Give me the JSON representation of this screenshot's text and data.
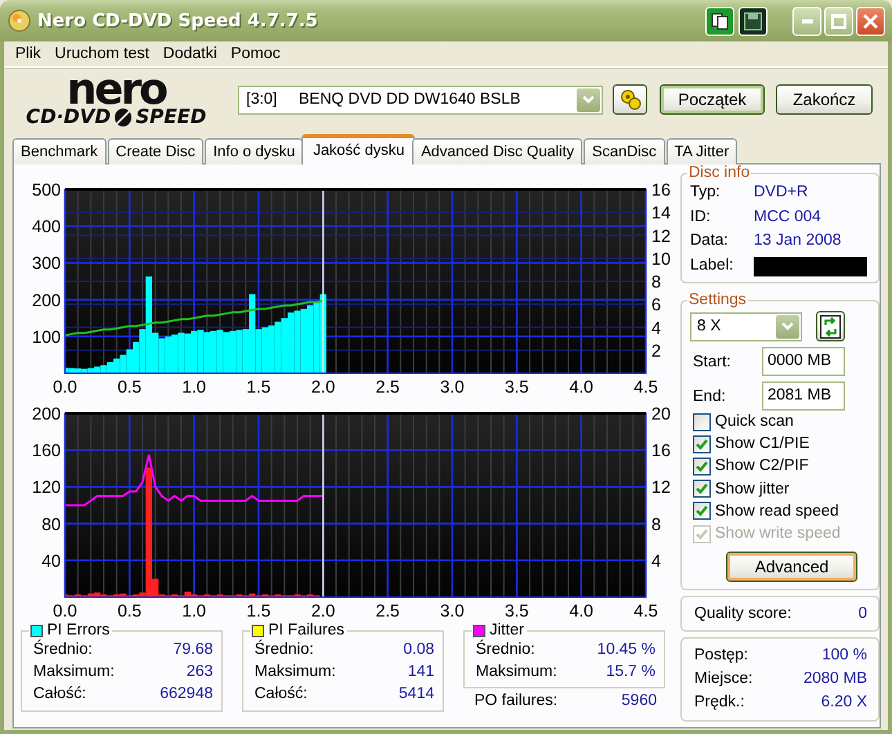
{
  "window": {
    "title": "Nero CD-DVD Speed 4.7.7.5"
  },
  "menu": [
    "Plik",
    "Uruchom test",
    "Dodatki",
    "Pomoc"
  ],
  "logo": {
    "top": "nero",
    "left": "CD·DVD",
    "right": "SPEED"
  },
  "drive": {
    "address": "[3:0]",
    "name": "BENQ DVD DD DW1640 BSLB"
  },
  "buttons": [
    {
      "label": "Początek",
      "focused": true
    },
    {
      "label": "Zakończ",
      "focused": false
    }
  ],
  "tabs": [
    {
      "label": "Benchmark",
      "selected": false
    },
    {
      "label": "Create Disc",
      "selected": false
    },
    {
      "label": "Info o dysku",
      "selected": false
    },
    {
      "label": "Jakość dysku",
      "selected": true
    },
    {
      "label": "Advanced Disc Quality",
      "selected": false
    },
    {
      "label": "ScanDisc",
      "selected": false
    },
    {
      "label": "TA Jitter",
      "selected": false
    }
  ],
  "charts": [
    {
      "chart_data": {
        "type": "bar",
        "x": [
          0,
          0.05,
          0.1,
          0.15,
          0.2,
          0.25,
          0.3,
          0.35,
          0.4,
          0.45,
          0.5,
          0.55,
          0.6,
          0.65,
          0.7,
          0.75,
          0.8,
          0.85,
          0.9,
          0.95,
          1.0,
          1.05,
          1.1,
          1.15,
          1.2,
          1.25,
          1.3,
          1.35,
          1.4,
          1.45,
          1.5,
          1.55,
          1.6,
          1.65,
          1.7,
          1.75,
          1.8,
          1.85,
          1.9,
          1.95,
          2.0
        ],
        "xlim": [
          0,
          4.5
        ],
        "ylim": [
          0,
          500
        ],
        "y2lim": [
          0,
          16
        ],
        "xticks": [
          {
            "value": 0,
            "label": "0.0"
          },
          {
            "value": 0.5,
            "label": "0.5"
          },
          {
            "value": 1,
            "label": "1.0"
          },
          {
            "value": 1.5,
            "label": "1.5"
          },
          {
            "value": 2,
            "label": "2.0"
          },
          {
            "value": 2.5,
            "label": "2.5"
          },
          {
            "value": 3,
            "label": "3.0"
          },
          {
            "value": 3.5,
            "label": "3.5"
          },
          {
            "value": 4,
            "label": "4.0"
          },
          {
            "value": 4.5,
            "label": "4.5"
          }
        ],
        "yticks": [
          100,
          200,
          300,
          400,
          500
        ],
        "y2ticks": [
          2,
          4,
          6,
          8,
          10,
          12,
          14,
          16
        ],
        "series": [
          {
            "color": "#00ffff",
            "values": [
              15,
              14,
              13,
              12,
              14,
              18,
              22,
              30,
              40,
              50,
              65,
              85,
              120,
              263,
              110,
              95,
              100,
              105,
              110,
              108,
              115,
              118,
              112,
              115,
              118,
              112,
              115,
              118,
              120,
              215,
              120,
              125,
              130,
              140,
              150,
              165,
              170,
              175,
              185,
              195,
              215
            ]
          },
          {
            "color": "#20c020",
            "type": "line",
            "axis": "y2",
            "values": [
              3.3,
              3.4,
              3.5,
              3.5,
              3.6,
              3.7,
              3.8,
              3.8,
              3.9,
              4.0,
              4.1,
              4.1,
              4.2,
              4.3,
              4.4,
              4.4,
              4.5,
              4.6,
              4.7,
              4.7,
              4.8,
              4.9,
              5.0,
              5.0,
              5.1,
              5.2,
              5.3,
              5.3,
              5.4,
              5.5,
              5.6,
              5.6,
              5.7,
              5.8,
              5.9,
              5.9,
              6.0,
              6.1,
              6.2,
              6.2,
              6.3
            ]
          }
        ],
        "grid": true,
        "ref_lines": [
          {
            "axis": "x",
            "value": 2.0
          }
        ]
      }
    },
    {
      "chart_data": {
        "type": "bar",
        "x": [
          0,
          0.05,
          0.1,
          0.15,
          0.2,
          0.25,
          0.3,
          0.35,
          0.4,
          0.45,
          0.5,
          0.55,
          0.6,
          0.65,
          0.7,
          0.75,
          0.8,
          0.85,
          0.9,
          0.95,
          1.0,
          1.05,
          1.1,
          1.15,
          1.2,
          1.25,
          1.3,
          1.35,
          1.4,
          1.45,
          1.5,
          1.55,
          1.6,
          1.65,
          1.7,
          1.75,
          1.8,
          1.85,
          1.9,
          1.95,
          2.0
        ],
        "xlim": [
          0,
          4.5
        ],
        "ylim": [
          0,
          200
        ],
        "y2lim": [
          0,
          20
        ],
        "xticks": [
          {
            "value": 0,
            "label": "0.0"
          },
          {
            "value": 0.5,
            "label": "0.5"
          },
          {
            "value": 1,
            "label": "1.0"
          },
          {
            "value": 1.5,
            "label": "1.5"
          },
          {
            "value": 2,
            "label": "2.0"
          },
          {
            "value": 2.5,
            "label": "2.5"
          },
          {
            "value": 3,
            "label": "3.0"
          },
          {
            "value": 3.5,
            "label": "3.5"
          },
          {
            "value": 4,
            "label": "4.0"
          },
          {
            "value": 4.5,
            "label": "4.5"
          }
        ],
        "yticks": [
          40,
          80,
          120,
          160,
          200
        ],
        "y2ticks": [
          4,
          8,
          12,
          16,
          20
        ],
        "series": [
          {
            "color": "#ff2020",
            "values": [
              3,
              2,
              3,
              2,
              4,
              5,
              3,
              2,
              3,
              4,
              2,
              3,
              5,
              141,
              20,
              3,
              2,
              3,
              2,
              6,
              3,
              2,
              3,
              2,
              3,
              2,
              2,
              3,
              2,
              4,
              2,
              3,
              2,
              3,
              2,
              2,
              3,
              2,
              3,
              2,
              null
            ]
          },
          {
            "color": "#ff00ff",
            "type": "line",
            "axis": "y2",
            "values": [
              10,
              10,
              10,
              10,
              10.5,
              11,
              11,
              11,
              11,
              11,
              11.5,
              11.5,
              12.5,
              15.5,
              12,
              11,
              10.5,
              11,
              10.5,
              11,
              11,
              10.5,
              10.5,
              10.5,
              10.5,
              10.5,
              10.5,
              10.5,
              10.5,
              11,
              10.5,
              10.5,
              10.5,
              10.5,
              10.5,
              10.5,
              10.5,
              11,
              11,
              11,
              11
            ]
          }
        ],
        "grid": true,
        "ref_lines": [
          {
            "axis": "x",
            "value": 2.0
          }
        ]
      }
    }
  ],
  "stats": [
    {
      "title": "PI Errors",
      "color": "#00ffff",
      "rows": [
        {
          "label": "Średnio:",
          "value": "79.68"
        },
        {
          "label": "Maksimum:",
          "value": "263"
        },
        {
          "label": "Całość:",
          "value": "662948"
        }
      ]
    },
    {
      "title": "PI Failures",
      "color": "#ffff00",
      "rows": [
        {
          "label": "Średnio:",
          "value": "0.08"
        },
        {
          "label": "Maksimum:",
          "value": "141"
        },
        {
          "label": "Całość:",
          "value": "5414"
        }
      ]
    },
    {
      "title": "Jitter",
      "color": "#ff00ff",
      "rows": [
        {
          "label": "Średnio:",
          "value": "10.45 %"
        },
        {
          "label": "Maksimum:",
          "value": "15.7 %"
        }
      ]
    }
  ],
  "po_failures": {
    "label": "PO failures:",
    "value": "5960"
  },
  "disc_info": {
    "title": "Disc info",
    "rows": [
      {
        "label": "Typ:",
        "value": "DVD+R"
      },
      {
        "label": "ID:",
        "value": "MCC 004"
      },
      {
        "label": "Data:",
        "value": "13 Jan 2008"
      },
      {
        "label": "Label:",
        "redacted": true
      }
    ]
  },
  "settings": {
    "title": "Settings",
    "speed": "8 X",
    "start": {
      "label": "Start:",
      "value": "0000 MB"
    },
    "end": {
      "label": "End:",
      "value": "2081 MB"
    },
    "options": [
      {
        "label": "Quick scan",
        "checked": false,
        "disabled": false
      },
      {
        "label": "Show C1/PIE",
        "checked": true,
        "disabled": false
      },
      {
        "label": "Show C2/PIF",
        "checked": true,
        "disabled": false
      },
      {
        "label": "Show jitter",
        "checked": true,
        "disabled": false
      },
      {
        "label": "Show read speed",
        "checked": true,
        "disabled": false
      },
      {
        "label": "Show write speed",
        "checked": true,
        "disabled": true
      }
    ],
    "advanced": {
      "label": "Advanced",
      "focused": true
    }
  },
  "quality": {
    "label": "Quality score:",
    "value": "0"
  },
  "progress": [
    {
      "label": "Postęp:",
      "value": "100 %"
    },
    {
      "label": "Miejsce:",
      "value": "2080 MB"
    },
    {
      "label": "Prędk.:",
      "value": "6.20 X"
    }
  ]
}
